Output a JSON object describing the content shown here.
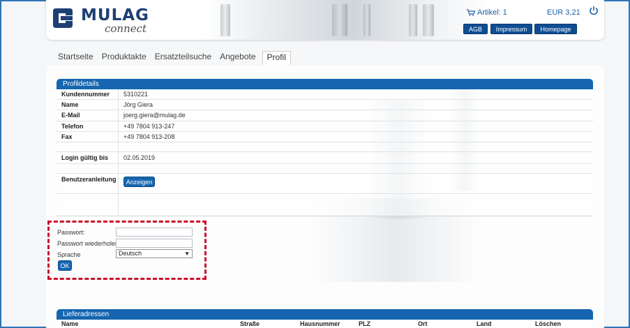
{
  "header": {
    "logo": {
      "name": "MULAG",
      "sub": "connect"
    },
    "cart": {
      "label": "Artikel: 1",
      "total": "EUR 3,21"
    },
    "buttons": {
      "agb": "AGB",
      "impressum": "Impressum",
      "homepage": "Homepage"
    },
    "icons": {
      "cart": "cart-icon",
      "power": "power-icon"
    }
  },
  "tabs": [
    {
      "label": "Startseite"
    },
    {
      "label": "Produktakte"
    },
    {
      "label": "Ersatzteilsuche"
    },
    {
      "label": "Angebote"
    },
    {
      "label": "Profil",
      "active": true
    }
  ],
  "profile": {
    "title": "Profildetails",
    "rows": [
      {
        "key": "Kundennummer",
        "value": "5310221"
      },
      {
        "key": "Name",
        "value": "Jörg Giera"
      },
      {
        "key": "E-Mail",
        "value": "joerg.giera@mulag.de"
      },
      {
        "key": "Telefon",
        "value": "+49 7804 913-247"
      },
      {
        "key": "Fax",
        "value": "+49 7804 913-208"
      },
      {
        "key": "",
        "value": ""
      },
      {
        "key": "Login gültig bis",
        "value": "02.05.2019"
      },
      {
        "key": "",
        "value": ""
      },
      {
        "key": "Benutzeranleitung",
        "value": ""
      }
    ],
    "manual_button": "Anzeigen"
  },
  "password_form": {
    "password_label": "Passwort:",
    "password_value": "",
    "repeat_label": "Passwort wiederholen:",
    "repeat_value": "",
    "language_label": "Sprache",
    "language_selected": "Deutsch",
    "ok_button": "OK"
  },
  "delivery": {
    "title": "Lieferadressen",
    "columns": [
      "Name",
      "Straße",
      "Hausnummer",
      "PLZ",
      "Ort",
      "Land",
      "Löschen"
    ]
  },
  "colors": {
    "brand_blue": "#1565b0",
    "header_button": "#0f4d92",
    "highlight_dashed": "#c8102e"
  }
}
